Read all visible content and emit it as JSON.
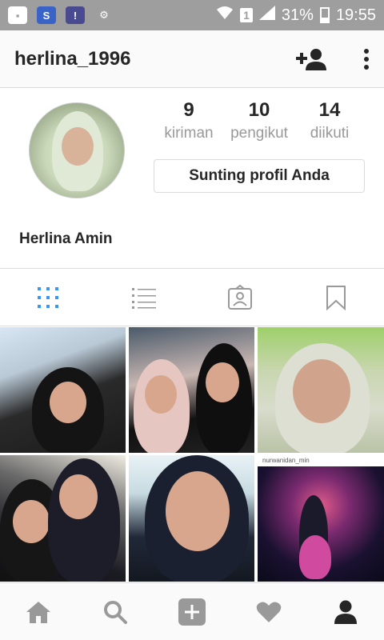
{
  "status_bar": {
    "battery_percent": "31%",
    "sim_label": "1",
    "time": "19:55"
  },
  "header": {
    "username": "herlina_1996",
    "icons": [
      "add-user-icon",
      "more-vertical-icon"
    ]
  },
  "profile": {
    "stats": [
      {
        "count": "9",
        "label": "kiriman"
      },
      {
        "count": "10",
        "label": "pengikut"
      },
      {
        "count": "14",
        "label": "diikuti"
      }
    ],
    "edit_button_label": "Sunting profil Anda",
    "full_name": "Herlina Amin"
  },
  "tabs": [
    {
      "icon": "grid-icon",
      "active": true
    },
    {
      "icon": "list-icon",
      "active": false
    },
    {
      "icon": "tagged-icon",
      "active": false
    },
    {
      "icon": "bookmark-icon",
      "active": false
    }
  ],
  "posts": {
    "post_6_caption": "nurwanidan_min"
  },
  "bottom_nav": [
    {
      "icon": "home-icon"
    },
    {
      "icon": "search-icon"
    },
    {
      "icon": "add-post-icon"
    },
    {
      "icon": "heart-icon"
    },
    {
      "icon": "profile-icon",
      "active": true
    }
  ],
  "colors": {
    "active_tab": "#3897f0",
    "inactive_icon": "#999999",
    "text": "#262626",
    "status_bar": "#9e9e9e"
  }
}
